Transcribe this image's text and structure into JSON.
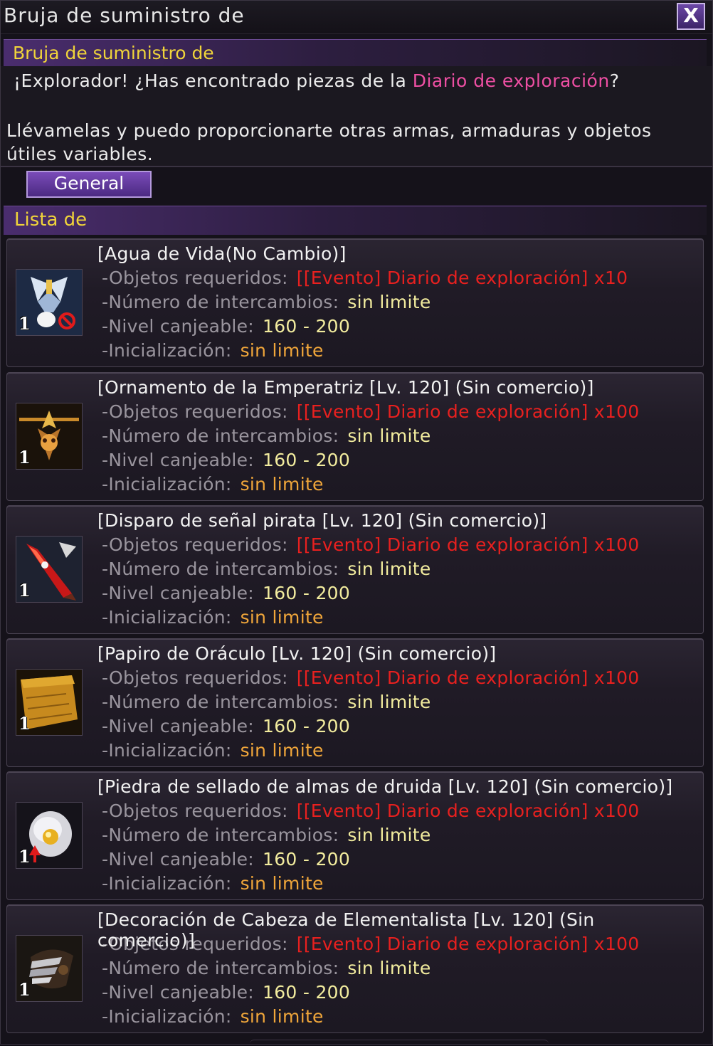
{
  "window": {
    "title": "Bruja de suministro de",
    "close_label": "X"
  },
  "header": {
    "title": "Bruja de suministro de"
  },
  "intro": {
    "line1_prefix": "¡Explorador!  ¿Has encontrado piezas de la ",
    "line1_highlight": "Diario de exploración",
    "line1_suffix": "?",
    "line2": "Llévamelas y puedo proporcionarte otras armas, armaduras y objetos útiles variables."
  },
  "tabs": [
    {
      "label": "General"
    }
  ],
  "list": {
    "title": "Lista de"
  },
  "labels": {
    "required": "-Objetos requeridos:",
    "exchanges": "-Número de intercambios:",
    "level": "-Nivel canjeable:",
    "reset": "-Inicialización:"
  },
  "items": [
    {
      "name": "[Agua de Vida(No Cambio)]",
      "icon": "water-of-life-icon",
      "quantity": "1",
      "required": "[[Evento] Diario de exploración] x10",
      "exchanges": "sin limite",
      "level": "160 - 200",
      "reset": "sin limite"
    },
    {
      "name": "[Ornamento de la Emperatriz [Lv. 120] (Sin comercio)]",
      "icon": "empress-ornament-icon",
      "quantity": "1",
      "required": "[[Evento] Diario de exploración] x100",
      "exchanges": "sin limite",
      "level": "160 - 200",
      "reset": "sin limite"
    },
    {
      "name": "[Disparo de señal pirata [Lv. 120] (Sin comercio)]",
      "icon": "pirate-flare-icon",
      "quantity": "1",
      "required": "[[Evento] Diario de exploración] x100",
      "exchanges": "sin limite",
      "level": "160 - 200",
      "reset": "sin limite"
    },
    {
      "name": "[Papiro de Oráculo [Lv. 120] (Sin comercio)]",
      "icon": "oracle-papyrus-icon",
      "quantity": "1",
      "required": "[[Evento] Diario de exploración] x100",
      "exchanges": "sin limite",
      "level": "160 - 200",
      "reset": "sin limite"
    },
    {
      "name": "[Piedra de sellado de almas de druida [Lv. 120] (Sin comercio)]",
      "icon": "druid-soul-stone-icon",
      "quantity": "1",
      "required": "[[Evento] Diario de exploración] x100",
      "exchanges": "sin limite",
      "level": "160 - 200",
      "reset": "sin limite"
    },
    {
      "name": "[Decoración de Cabeza de Elementalista [Lv. 120] (Sin comercio)]",
      "icon": "elementalist-head-decoration-icon",
      "quantity": "1",
      "required": "[[Evento] Diario de exploración] x100",
      "exchanges": "sin limite",
      "level": "160 - 200",
      "reset": "sin limite"
    }
  ]
}
